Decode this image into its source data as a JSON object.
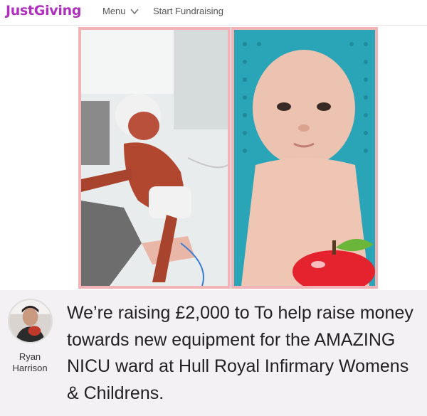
{
  "header": {
    "logo": "JustGiving",
    "menu_label": "Menu",
    "start_label": "Start Fundraising"
  },
  "fundraiser": {
    "owner_first": "Ryan",
    "owner_last": "Harrison",
    "headline": "We’re raising £2,000 to To help raise money towards new equipment for the AMAZING NICU ward at Hull Royal Infirmary Womens & Childrens."
  },
  "colors": {
    "brand": "#b02fbf",
    "photo_border": "#f2b3b7",
    "panel_bg": "#f3f1f3"
  },
  "icons": [
    "chevron-down-icon",
    "apple-icon"
  ]
}
